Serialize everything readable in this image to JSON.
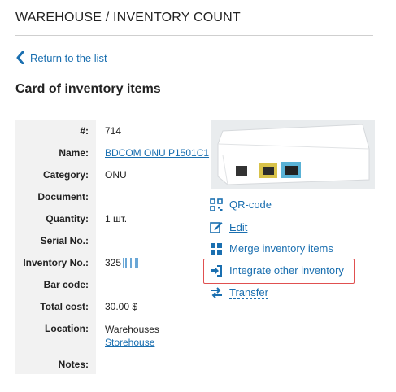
{
  "header": {
    "title": "WAREHOUSE / INVENTORY COUNT"
  },
  "nav": {
    "back_label": "Return to the list"
  },
  "card": {
    "title": "Card of inventory items",
    "fields": [
      {
        "label": "#:",
        "value": "714"
      },
      {
        "label": "Name:",
        "value": "BDCOM ONU P1501C1"
      },
      {
        "label": "Category:",
        "value": "ONU"
      },
      {
        "label": "Document:",
        "value": ""
      },
      {
        "label": "Quantity:",
        "value": "1 шт."
      },
      {
        "label": "Serial No.:",
        "value": ""
      },
      {
        "label": "Inventory No.:",
        "value": "325"
      },
      {
        "label": "Bar code:",
        "value": ""
      },
      {
        "label": "Total cost:",
        "value": "30.00 $"
      },
      {
        "label": "Location:",
        "value": "Warehouses",
        "link": "Storehouse"
      },
      {
        "label": "Notes:",
        "value": ""
      }
    ]
  },
  "actions": {
    "qr": "QR-code",
    "edit": "Edit",
    "merge": "Merge inventory items",
    "integrate": "Integrate other inventory",
    "transfer": "Transfer"
  },
  "colors": {
    "link": "#1a6fb0",
    "highlight": "#e05050",
    "label_bg": "#f2f2f2"
  }
}
